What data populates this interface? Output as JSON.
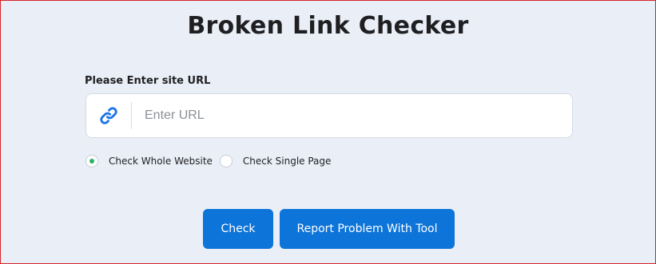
{
  "page": {
    "title": "Broken Link Checker"
  },
  "form": {
    "url_label": "Please Enter site URL",
    "url_placeholder": "Enter URL",
    "url_value": "",
    "link_icon": "link-icon",
    "mode_options": [
      {
        "label": "Check Whole Website",
        "selected": true
      },
      {
        "label": "Check Single Page",
        "selected": false
      }
    ]
  },
  "actions": {
    "check_label": "Check",
    "report_label": "Report Problem With Tool"
  },
  "colors": {
    "background": "#e9eef7",
    "primary_button": "#0d74d9",
    "link_icon": "#1a73e8",
    "radio_selected": "#28b463",
    "frame_border": "#d9242b"
  }
}
